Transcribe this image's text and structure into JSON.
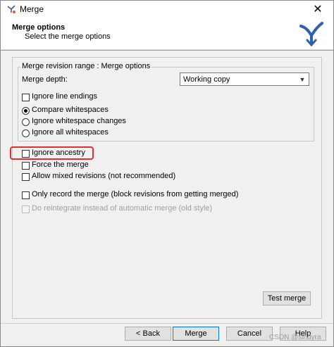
{
  "window": {
    "title": "Merge",
    "close_glyph": "✕"
  },
  "header": {
    "title": "Merge options",
    "subtitle": "Select the merge options",
    "logo_icon": "tortoisesvn-merge-icon"
  },
  "group": {
    "legend": "Merge revision range : Merge options",
    "depth_label": "Merge depth:",
    "depth_value": "Working copy",
    "ignore_line_endings": "Ignore line endings",
    "whitespace_options": [
      {
        "label": "Compare whitespaces",
        "checked": true
      },
      {
        "label": "Ignore whitespace changes",
        "checked": false
      },
      {
        "label": "Ignore all whitespaces",
        "checked": false
      }
    ]
  },
  "options": {
    "ignore_ancestry": "Ignore ancestry",
    "force_merge": "Force the merge",
    "allow_mixed": "Allow mixed revisions (not recommended)",
    "only_record": "Only record the merge (block revisions from getting merged)",
    "reintegrate": "Do reintegrate instead of automatic merge (old style)"
  },
  "buttons": {
    "test_merge": "Test merge",
    "back": "< Back",
    "merge": "Merge",
    "cancel": "Cancel",
    "help": "Help"
  },
  "watermark": "CSDN @sindyra",
  "colors": {
    "highlight": "#e0312f",
    "logo": "#2f5fb3"
  }
}
